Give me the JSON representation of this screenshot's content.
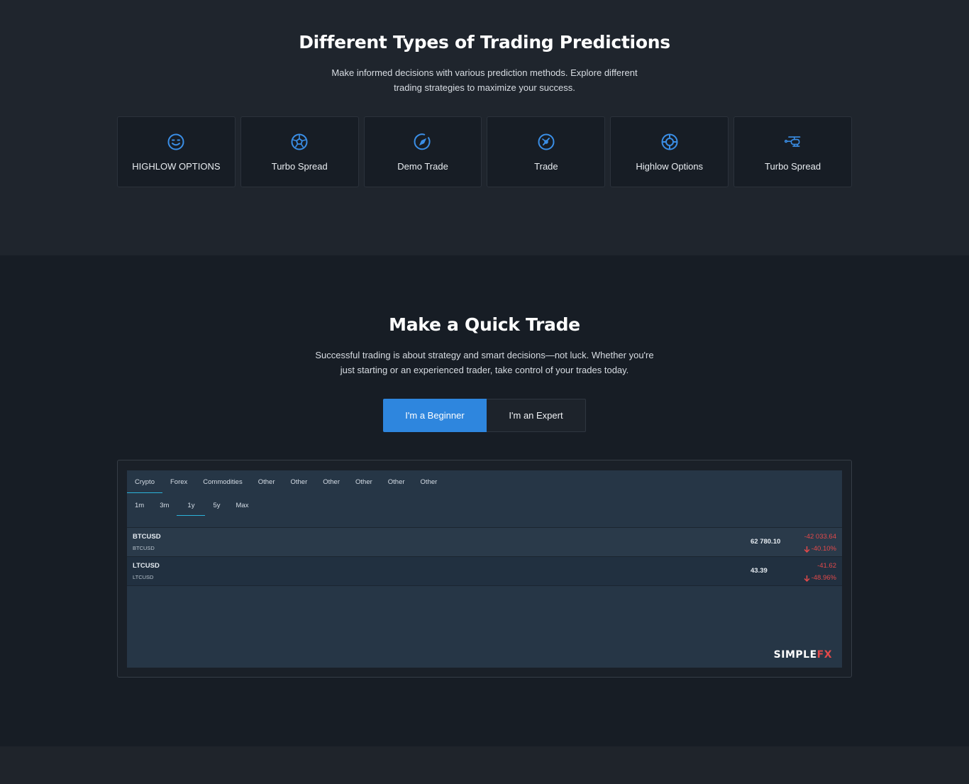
{
  "predictions": {
    "title": "Different Types of Trading Predictions",
    "subtitle_line1": "Make informed decisions with various prediction methods. Explore different",
    "subtitle_line2": "trading strategies to maximize your success.",
    "cards": [
      {
        "label": "HIGHLOW OPTIONS",
        "icon": "smile-icon"
      },
      {
        "label": "Turbo Spread",
        "icon": "soccer-ball-icon"
      },
      {
        "label": "Demo Trade",
        "icon": "compass-icon"
      },
      {
        "label": "Trade",
        "icon": "gauge-icon"
      },
      {
        "label": "Highlow Options",
        "icon": "life-ring-icon"
      },
      {
        "label": "Turbo Spread",
        "icon": "helicopter-icon"
      }
    ]
  },
  "quick_trade": {
    "title": "Make a Quick Trade",
    "subtitle_line1": "Successful trading is about strategy and smart decisions—not luck. Whether you're",
    "subtitle_line2": "just starting or an experienced trader, take control of your trades today.",
    "beginner_label": "I'm a Beginner",
    "expert_label": "I'm an Expert"
  },
  "widget": {
    "tabs": [
      "Crypto",
      "Forex",
      "Commodities",
      "Other",
      "Other",
      "Other",
      "Other",
      "Other",
      "Other"
    ],
    "active_tab": "Crypto",
    "ranges": [
      "1m",
      "3m",
      "1y",
      "5y",
      "Max"
    ],
    "active_range": "1y",
    "rows": [
      {
        "symbol": "BTCUSD",
        "sub": "BTCUSD",
        "price": "62 780.10",
        "change": "-42 033.64",
        "percent": "-40.10%"
      },
      {
        "symbol": "LTCUSD",
        "sub": "LTCUSD",
        "price": "43.39",
        "change": "-41.62",
        "percent": "-48.96%"
      }
    ],
    "logo_main": "SIMPLE",
    "logo_accent": "FX"
  },
  "colors": {
    "accent": "#2e86de",
    "icon": "#3a8ee6",
    "negative": "#e2494a",
    "tab_underline": "#2bb3d9"
  }
}
